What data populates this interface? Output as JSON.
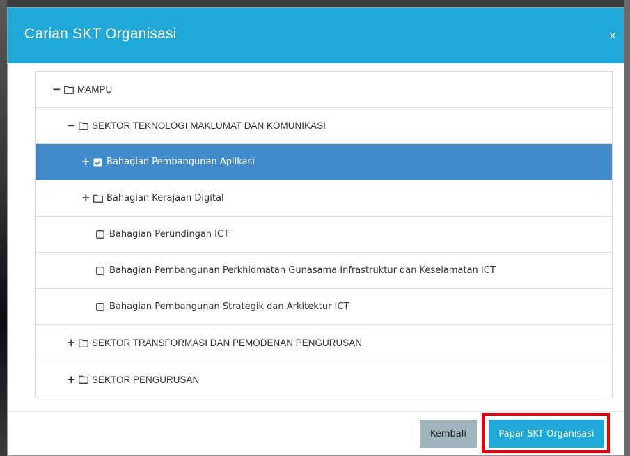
{
  "modal": {
    "title": "Carian SKT Organisasi",
    "close_glyph": "×"
  },
  "tree": {
    "nodes": [
      {
        "label": "MAMPU",
        "toggle": "-",
        "icon": "folder-icon"
      },
      {
        "label": "SEKTOR TEKNOLOGI MAKLUMAT DAN KOMUNIKASI",
        "toggle": "-",
        "icon": "folder-icon"
      },
      {
        "label": "Bahagian Pembangunan Aplikasi",
        "toggle": "+",
        "icon": "checked-checkbox-icon",
        "selected": true
      },
      {
        "label": "Bahagian Kerajaan Digital",
        "toggle": "+",
        "icon": "folder-icon"
      },
      {
        "label": "Bahagian Perundingan ICT",
        "toggle": "",
        "icon": "square-icon"
      },
      {
        "label": "Bahagian Pembangunan Perkhidmatan Gunasama Infrastruktur dan Keselamatan ICT",
        "toggle": "",
        "icon": "square-icon"
      },
      {
        "label": "Bahagian Pembangunan Strategik dan Arkitektur ICT",
        "toggle": "",
        "icon": "square-icon"
      },
      {
        "label": "SEKTOR TRANSFORMASI DAN PEMODENAN PENGURUSAN",
        "toggle": "+",
        "icon": "folder-icon"
      },
      {
        "label": "SEKTOR PENGURUSAN",
        "toggle": "+",
        "icon": "folder-icon"
      }
    ]
  },
  "footer": {
    "back_label": "Kembali",
    "show_label": "Papar SKT Organisasi"
  },
  "colors": {
    "header": "#1fa8d8",
    "selected_row": "#428bca",
    "back_button": "#9fb4bc",
    "highlight": "#e8000b"
  }
}
